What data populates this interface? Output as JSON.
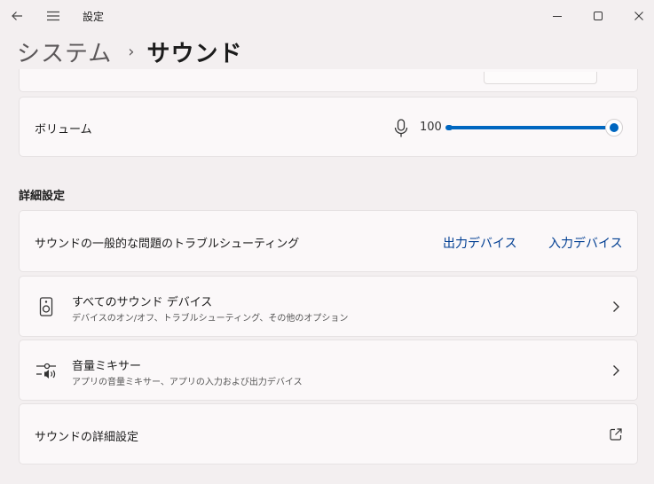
{
  "window": {
    "app_title": "設定"
  },
  "breadcrumb": {
    "parent": "システム",
    "separator": "›",
    "current": "サウンド"
  },
  "volume": {
    "label": "ボリューム",
    "value": "100",
    "level_percent": 100
  },
  "advanced": {
    "header": "詳細設定",
    "troubleshoot": {
      "label": "サウンドの一般的な問題のトラブルシューティング",
      "output_link": "出力デバイス",
      "input_link": "入力デバイス"
    },
    "all_devices": {
      "title": "すべてのサウンド デバイス",
      "subtitle": "デバイスのオン/オフ、トラブルシューティング、その他のオプション"
    },
    "mixer": {
      "title": "音量ミキサー",
      "subtitle": "アプリの音量ミキサー、アプリの入力および出力デバイス"
    },
    "more_settings": {
      "label": "サウンドの詳細設定"
    }
  },
  "icons": {
    "back": "arrow-left-icon",
    "menu": "hamburger-menu-icon",
    "mic": "microphone-icon",
    "speaker": "speaker-device-icon",
    "mixer": "mixer-icon",
    "chevron": "chevron-right-icon",
    "external": "open-external-icon"
  },
  "colors": {
    "accent": "#0067c0",
    "link": "#003e92",
    "background": "#f3eff0",
    "card": "#fbf8f9"
  }
}
